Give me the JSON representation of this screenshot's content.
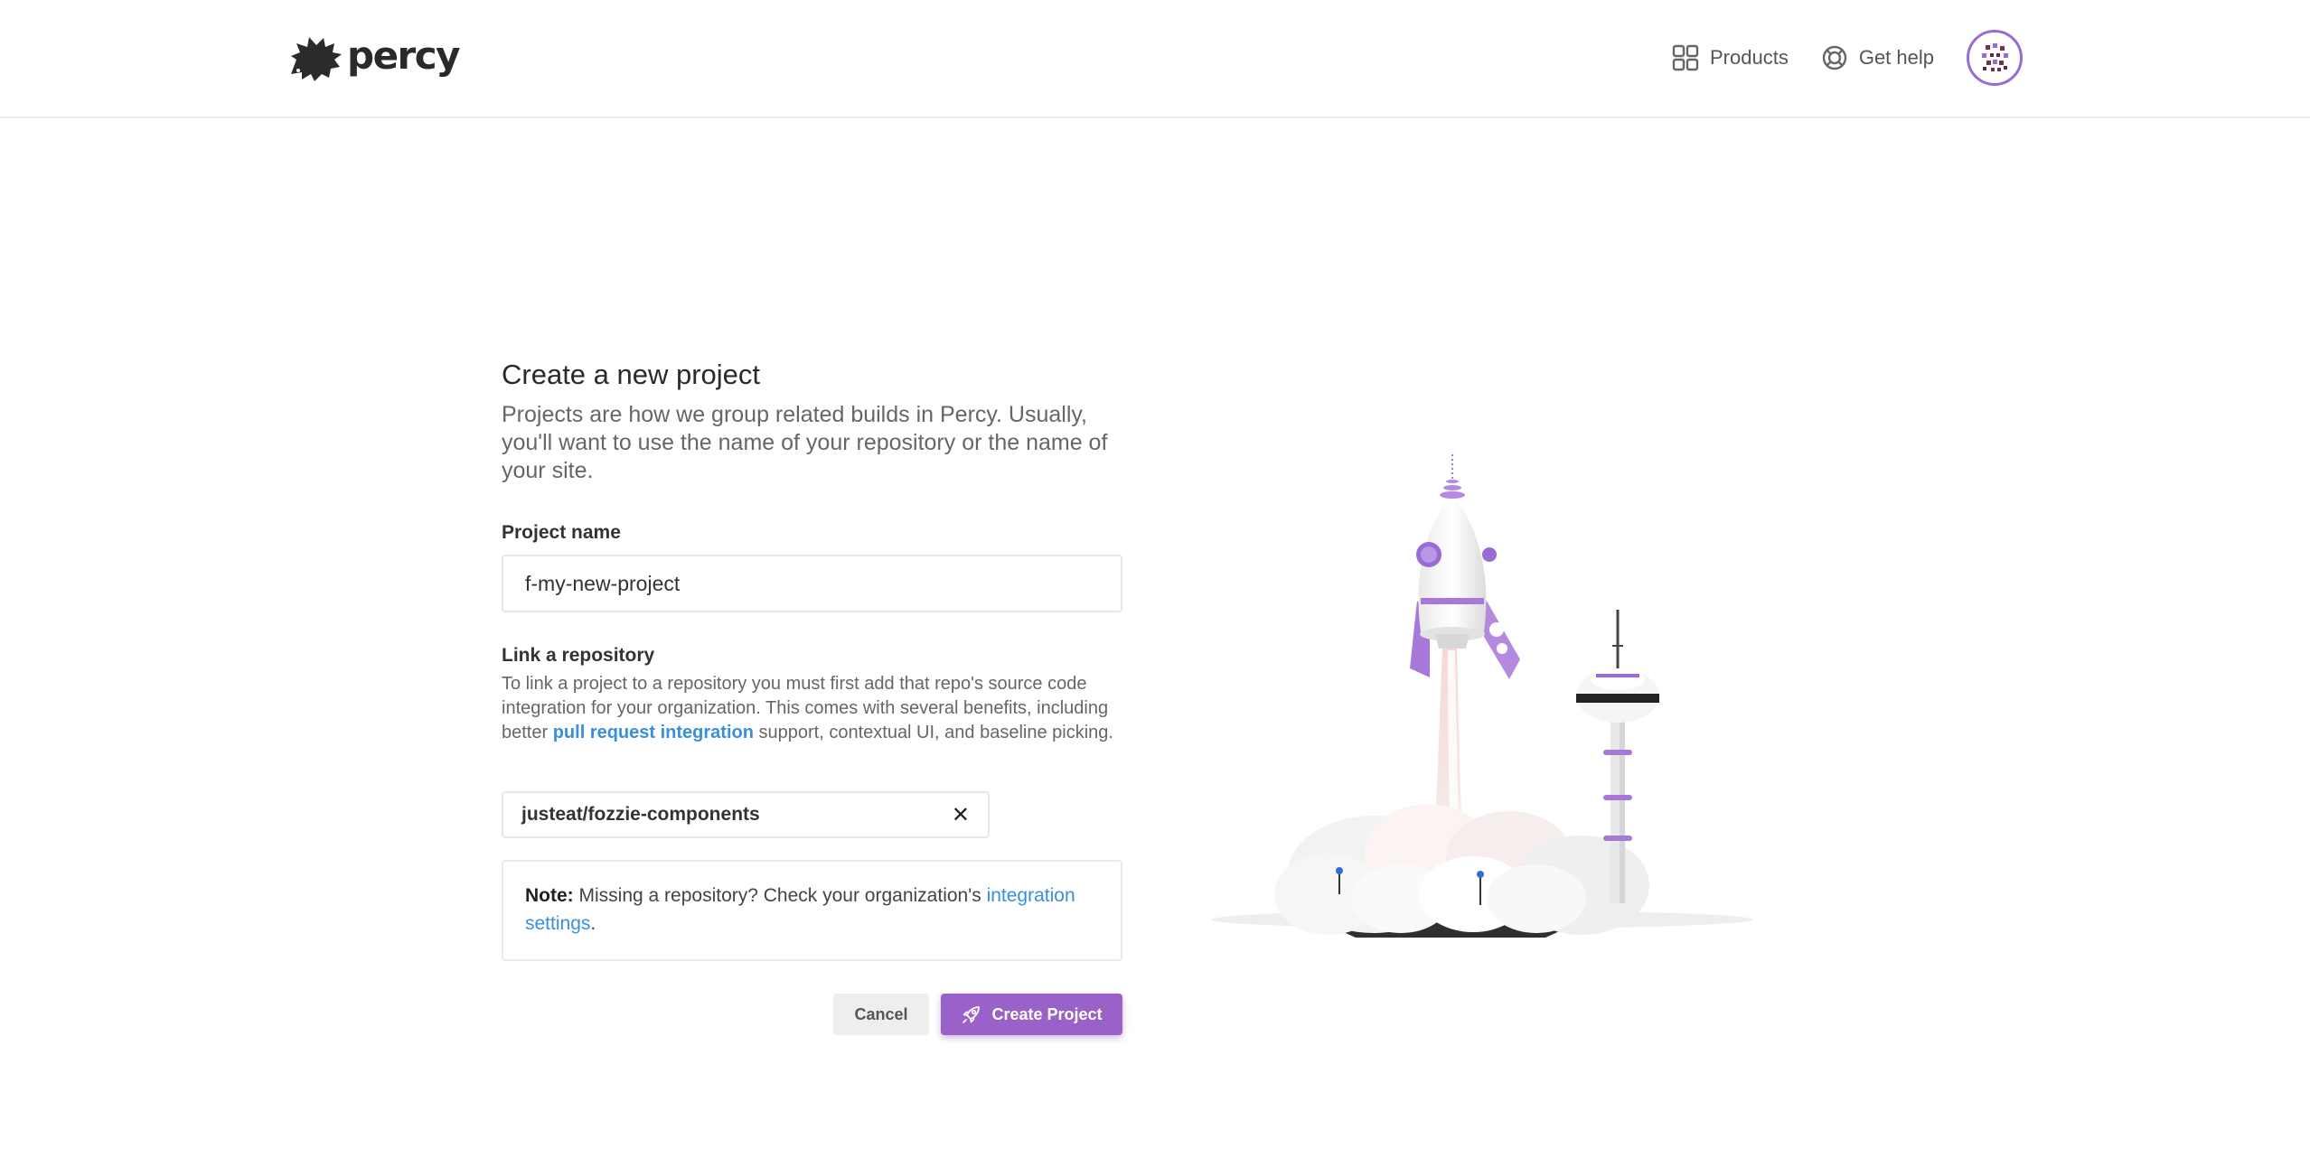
{
  "header": {
    "brand": "percy",
    "nav": {
      "products_label": "Products",
      "help_label": "Get help"
    }
  },
  "form": {
    "title": "Create a new project",
    "subtitle": "Projects are how we group related builds in Percy. Usually, you'll want to use the name of your repository or the name of your site.",
    "project_name": {
      "label": "Project name",
      "value": "f-my-new-project"
    },
    "repository": {
      "label": "Link a repository",
      "desc_part1": "To link a project to a repository you must first add that repo's source code integration for your organization. This comes with several benefits, including better ",
      "desc_link": "pull request integration",
      "desc_part2": " support, contextual UI, and baseline picking.",
      "selected": "justeat/fozzie-components",
      "clear_symbol": "✕"
    },
    "note": {
      "prefix": "Note:",
      "text": " Missing a repository? Check your organization's ",
      "link": "integration settings",
      "suffix": "."
    },
    "buttons": {
      "cancel": "Cancel",
      "create": "Create Project"
    }
  },
  "colors": {
    "accent": "#9a62c9",
    "link": "#3a8fdc"
  }
}
